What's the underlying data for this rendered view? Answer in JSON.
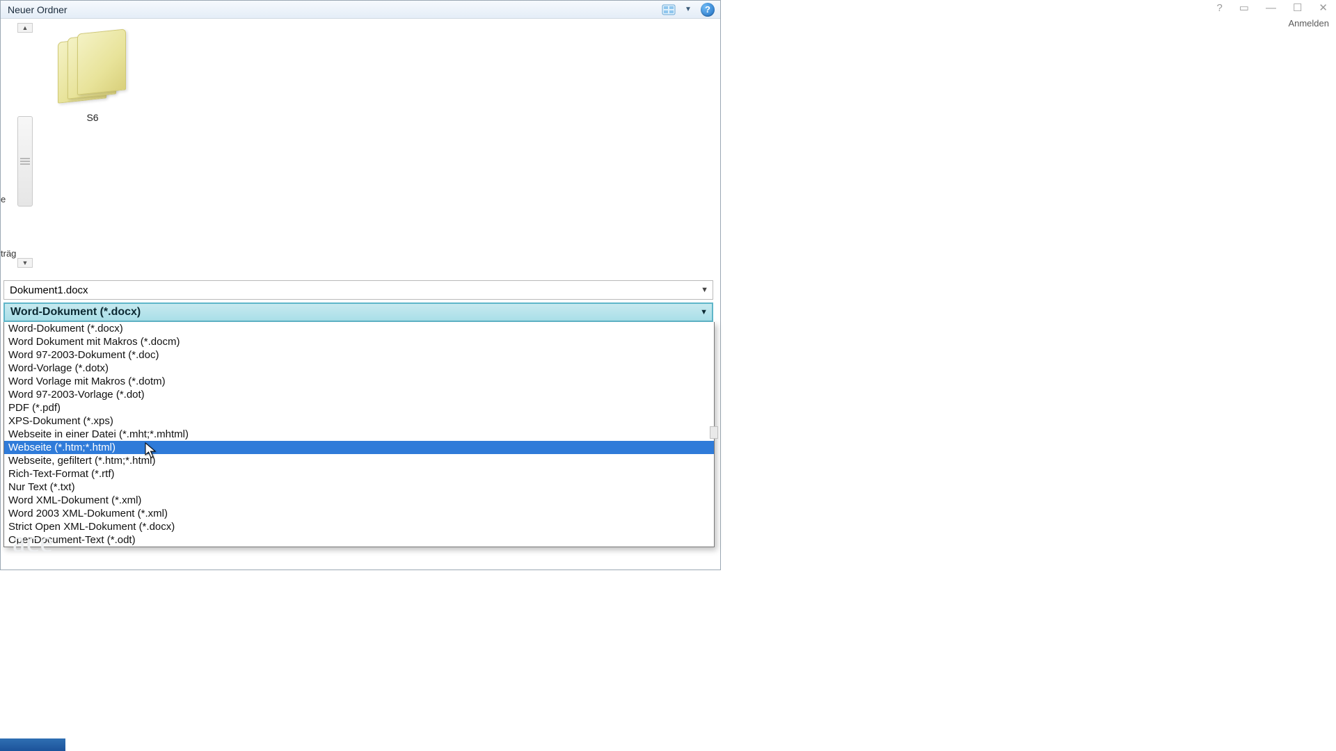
{
  "window": {
    "title": "Neuer Ordner"
  },
  "folder": {
    "name": "S6"
  },
  "left_edge": {
    "a": "e",
    "b": "träg"
  },
  "filename": {
    "value": "Dokument1.docx"
  },
  "filetype": {
    "selected": "Word-Dokument (*.docx)",
    "options": [
      "Word-Dokument (*.docx)",
      "Word Dokument mit Makros (*.docm)",
      "Word 97-2003-Dokument (*.doc)",
      "Word-Vorlage (*.dotx)",
      "Word Vorlage mit Makros (*.dotm)",
      "Word 97-2003-Vorlage (*.dot)",
      "PDF (*.pdf)",
      "XPS-Dokument (*.xps)",
      "Webseite in einer Datei (*.mht;*.mhtml)",
      "Webseite (*.htm;*.html)",
      "Webseite, gefiltert (*.htm;*.html)",
      "Rich-Text-Format (*.rtf)",
      "Nur Text (*.txt)",
      "Word XML-Dokument (*.xml)",
      "Word 2003 XML-Dokument (*.xml)",
      "Strict Open XML-Dokument (*.docx)",
      "OpenDocument-Text (*.odt)"
    ],
    "highlighted_index": 9
  },
  "app": {
    "signin": "Anmelden"
  }
}
